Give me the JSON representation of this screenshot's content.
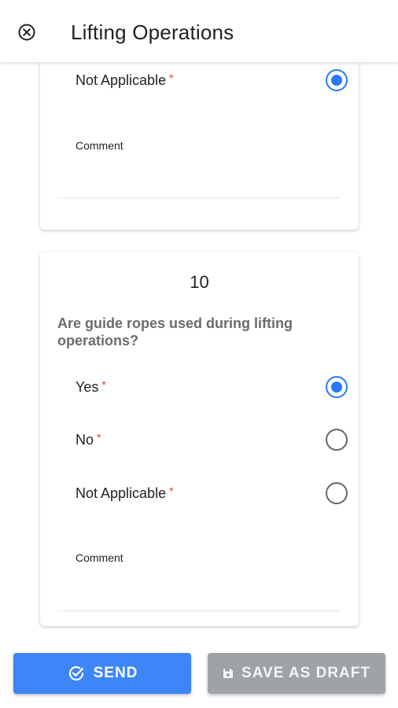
{
  "header": {
    "title": "Lifting Operations",
    "close_icon": "close-circle-icon"
  },
  "previous_question": {
    "options": [
      {
        "label": "Not Applicable",
        "required_mark": "*",
        "selected": true
      }
    ],
    "comment_label": "Comment"
  },
  "question": {
    "number": "10",
    "text": "Are guide ropes used during lifting operations?",
    "options": [
      {
        "label": "Yes",
        "required_mark": "*",
        "selected": true
      },
      {
        "label": "No",
        "required_mark": "*",
        "selected": false
      },
      {
        "label": "Not Applicable",
        "required_mark": "*",
        "selected": false
      }
    ],
    "comment_label": "Comment"
  },
  "actions": {
    "send_label": "SEND",
    "send_icon": "check-circle-icon",
    "draft_label": "SAVE AS DRAFT",
    "draft_icon": "save-icon"
  },
  "colors": {
    "accent": "#2979ff",
    "send_button": "#3d86f7",
    "draft_button": "#9ea3a8",
    "required": "#e53935"
  }
}
